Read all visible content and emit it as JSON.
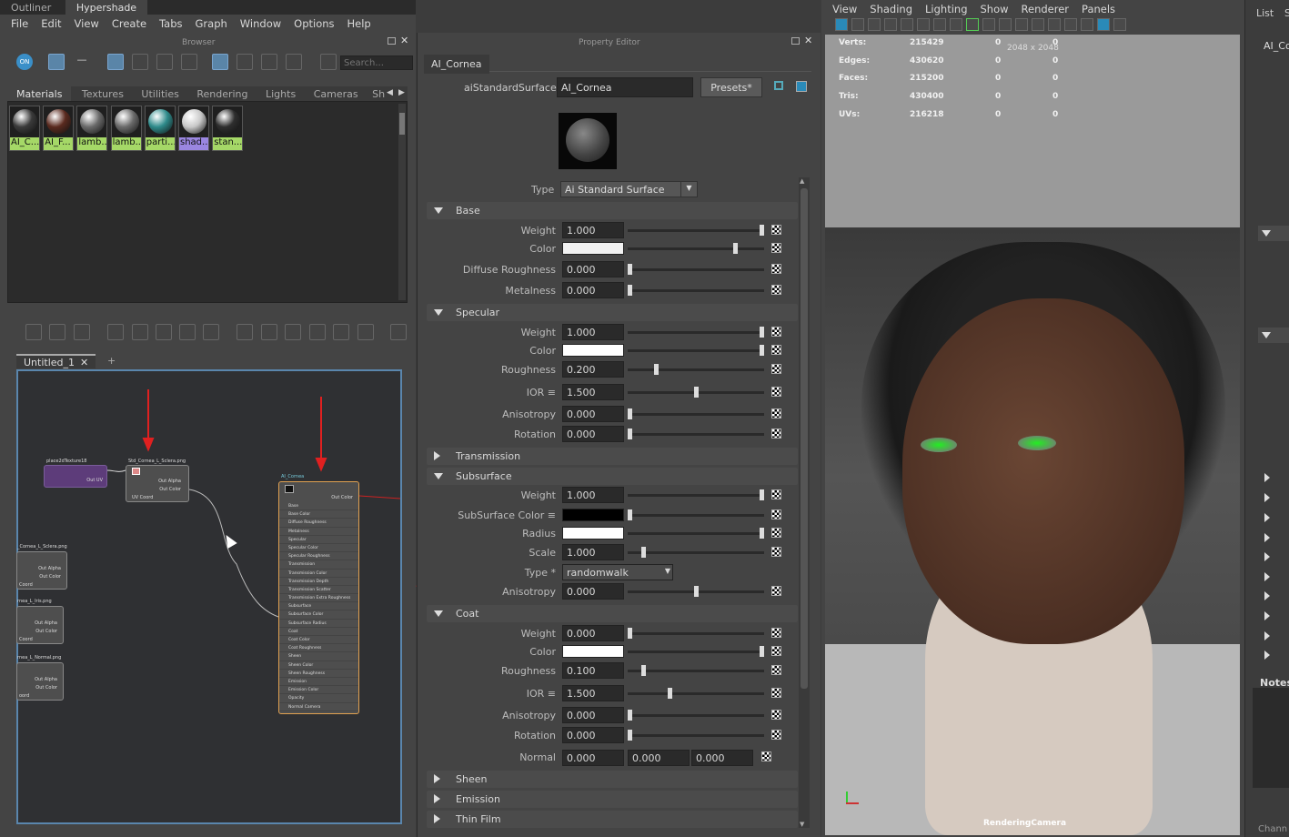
{
  "top_tabs": [
    "Outliner",
    "Hypershade"
  ],
  "menu": [
    "File",
    "Edit",
    "View",
    "Create",
    "Tabs",
    "Graph",
    "Window",
    "Options",
    "Help"
  ],
  "browser": {
    "title": "Browser",
    "search_placeholder": "Search...",
    "tabs": [
      "Materials",
      "Textures",
      "Utilities",
      "Rendering",
      "Lights",
      "Cameras",
      "Sh"
    ],
    "materials": [
      {
        "label": "AI_C...",
        "color": "#3a3a3a",
        "label_color": "#a5d867"
      },
      {
        "label": "AI_F...",
        "color": "#5a2a1f",
        "label_color": "#a5d867"
      },
      {
        "label": "lamb...",
        "color": "#6a6a6a",
        "label_color": "#a5d867"
      },
      {
        "label": "lamb...",
        "color": "#6a6a6a",
        "label_color": "#a5d867"
      },
      {
        "label": "parti...",
        "color": "#2e8a8a",
        "label_color": "#a5d867"
      },
      {
        "label": "shad...",
        "color": "#c8c8c8",
        "label_color": "#9a86e0"
      },
      {
        "label": "stan...",
        "color": "#2e2e2e",
        "label_color": "#a5d867"
      }
    ]
  },
  "graph": {
    "tab_label": "Untitled_1",
    "add_tab": "+",
    "nodes": {
      "place2d": {
        "title": "place2dTexture18",
        "ports": [
          "Out UV"
        ]
      },
      "sclera": {
        "title": "Std_Cornea_L_Sclera.png",
        "ports": [
          "Out Alpha",
          "Out Color",
          "UV Coord"
        ]
      },
      "cornea": {
        "title": "AI_Cornea",
        "out": "Out Color",
        "ports": [
          "Base",
          "Base Color",
          "Diffuse Roughness",
          "Metalness",
          "Specular",
          "Specular Color",
          "Specular Roughness",
          "Transmission",
          "Transmission Color",
          "Transmission Depth",
          "Transmission Scatter",
          "Transmission Extra Roughness",
          "Subsurface",
          "Subsurface Color",
          "Subsurface Radius",
          "Coat",
          "Coat Color",
          "Coat Roughness",
          "Sheen",
          "Sheen Color",
          "Sheen Roughness",
          "Emission",
          "Emission Color",
          "Opacity",
          "Normal Camera"
        ]
      },
      "left1": {
        "title": "_Cornea_L_Sclera.png",
        "ports": [
          "Out Alpha",
          "Out Color",
          "Coord"
        ]
      },
      "left2": {
        "title": "rnea_L_Iris.png",
        "ports": [
          "Out Alpha",
          "Out Color",
          "Coord"
        ]
      },
      "left3": {
        "title": "rnea_L_Normal.png",
        "ports": [
          "Out Alpha",
          "Out Color",
          "oord"
        ]
      }
    }
  },
  "property_editor": {
    "title": "Property Editor",
    "node_tab": "AI_Cornea",
    "type_label": "aiStandardSurface:",
    "node_name": "AI_Cornea",
    "presets": "Presets*",
    "shader_type_label": "Type",
    "shader_type": "Ai Standard Surface",
    "sections": {
      "base": {
        "label": "Base",
        "rows": [
          {
            "label": "Weight",
            "value": "1.000",
            "pos": 1.0
          },
          {
            "label": "Color",
            "swatch": "#f2f2f2",
            "pos": 0.8
          },
          {
            "label": "Diffuse Roughness",
            "value": "0.000",
            "pos": 0.0
          },
          {
            "label": "Metalness",
            "value": "0.000",
            "pos": 0.0
          }
        ]
      },
      "specular": {
        "label": "Specular",
        "rows": [
          {
            "label": "Weight",
            "value": "1.000",
            "pos": 1.0
          },
          {
            "label": "Color",
            "swatch": "#ffffff",
            "pos": 1.0
          },
          {
            "label": "Roughness",
            "value": "0.200",
            "pos": 0.2
          },
          {
            "label": "IOR ≡",
            "value": "1.500",
            "pos": 0.5
          },
          {
            "label": "Anisotropy",
            "value": "0.000",
            "pos": 0.0
          },
          {
            "label": "Rotation",
            "value": "0.000",
            "pos": 0.0
          }
        ]
      },
      "transmission": {
        "label": "Transmission"
      },
      "subsurface": {
        "label": "Subsurface",
        "rows": [
          {
            "label": "Weight",
            "value": "1.000",
            "pos": 1.0
          },
          {
            "label": "SubSurface Color ≡",
            "swatch": "#000000",
            "pos": 0.0
          },
          {
            "label": "Radius",
            "swatch": "#ffffff",
            "pos": 1.0
          },
          {
            "label": "Scale",
            "value": "1.000",
            "pos": 0.1
          },
          {
            "label": "Type *",
            "dropdown": "randomwalk"
          },
          {
            "label": "Anisotropy",
            "value": "0.000",
            "pos": 0.5
          }
        ]
      },
      "coat": {
        "label": "Coat",
        "rows": [
          {
            "label": "Weight",
            "value": "0.000",
            "pos": 0.0
          },
          {
            "label": "Color",
            "swatch": "#ffffff",
            "pos": 1.0
          },
          {
            "label": "Roughness",
            "value": "0.100",
            "pos": 0.1
          },
          {
            "label": "IOR ≡",
            "value": "1.500",
            "pos": 0.3
          },
          {
            "label": "Anisotropy",
            "value": "0.000",
            "pos": 0.0
          },
          {
            "label": "Rotation",
            "value": "0.000",
            "pos": 0.0
          }
        ]
      },
      "normal": {
        "label": "Normal",
        "values": [
          "0.000",
          "0.000",
          "0.000"
        ]
      },
      "sheen": {
        "label": "Sheen"
      },
      "emission": {
        "label": "Emission"
      },
      "thin_film": {
        "label": "Thin Film"
      }
    }
  },
  "viewport": {
    "menu": [
      "View",
      "Shading",
      "Lighting",
      "Show",
      "Renderer",
      "Panels"
    ],
    "stats": [
      {
        "label": "Verts:",
        "v1": "215429",
        "v2": "0",
        "v3": "0"
      },
      {
        "label": "Edges:",
        "v1": "430620",
        "v2": "0",
        "v3": "0"
      },
      {
        "label": "Faces:",
        "v1": "215200",
        "v2": "0",
        "v3": "0"
      },
      {
        "label": "Tris:",
        "v1": "430400",
        "v2": "0",
        "v3": "0"
      },
      {
        "label": "UVs:",
        "v1": "216218",
        "v2": "0",
        "v3": "0"
      }
    ],
    "resolution": "2048 x 2048",
    "camera": "RenderingCamera"
  },
  "right_panel": {
    "tabs": [
      "List",
      "S"
    ],
    "name": "AI_Co",
    "notes": "Notes:",
    "channel": "Chann"
  }
}
